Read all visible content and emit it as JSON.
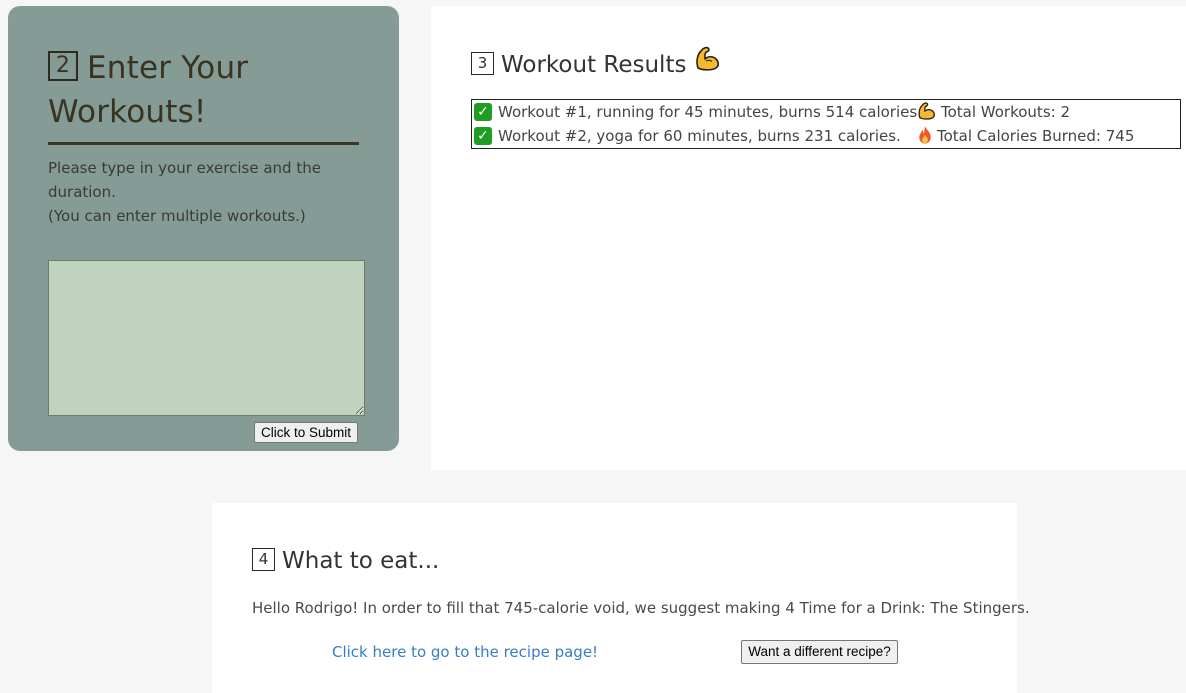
{
  "enter_panel": {
    "step_number": "2",
    "title": "Enter Your Workouts!",
    "instruction_line1": "Please type in your exercise and the duration.",
    "instruction_line2": "(You can enter multiple workouts.)",
    "textarea_value": "",
    "submit_label": "Click to Submit",
    "background_color": "#849b96",
    "textarea_color": "#bfd3be"
  },
  "results_panel": {
    "step_number": "3",
    "title": "Workout Results",
    "title_icon": "flexed-biceps-icon",
    "workouts": [
      {
        "icon": "check-mark-icon",
        "text": "Workout #1, running for 45 minutes, burns 514 calories."
      },
      {
        "icon": "check-mark-icon",
        "text": "Workout #2, yoga for 60 minutes, burns 231 calories."
      }
    ],
    "total_workouts_icon": "flexed-biceps-icon",
    "total_workouts": "Total Workouts: 2",
    "total_calories_icon": "fire-icon",
    "total_calories": "Total Calories Burned: 745"
  },
  "eat_panel": {
    "step_number": "4",
    "title": "What to eat...",
    "suggestion": "Hello Rodrigo! In order to fill that 745-calorie void, we suggest making 4 Time for a Drink: The Stingers.",
    "recipe_link": "Click here to go to the recipe page!",
    "different_recipe_label": "Want a different recipe?",
    "link_color": "#3a7bc8"
  }
}
